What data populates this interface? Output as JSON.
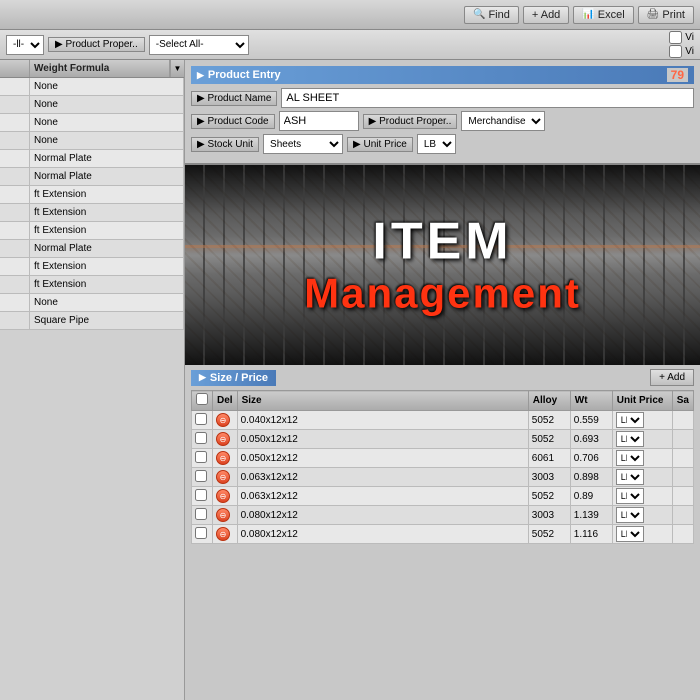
{
  "toolbar": {
    "find_label": "Find",
    "add_label": "+ Add",
    "excel_label": "Excel",
    "print_label": "Print"
  },
  "filter": {
    "all_label": "-ll-",
    "product_proper_label": "▶ Product Proper..",
    "select_all_label": "-Select All-",
    "checkbox1": "Vi",
    "checkbox2": "Vi"
  },
  "left_panel": {
    "col1_header": "",
    "col2_header": "Weight Formula",
    "rows": [
      {
        "col1": "",
        "col2": "None"
      },
      {
        "col1": "",
        "col2": "None"
      },
      {
        "col1": "",
        "col2": "None"
      },
      {
        "col1": "",
        "col2": "None"
      },
      {
        "col1": "",
        "col2": "Normal Plate"
      },
      {
        "col1": "",
        "col2": "Normal Plate"
      },
      {
        "col1": "",
        "col2": "ft Extension"
      },
      {
        "col1": "",
        "col2": "ft Extension"
      },
      {
        "col1": "",
        "col2": "ft Extension"
      },
      {
        "col1": "",
        "col2": "Normal Plate"
      },
      {
        "col1": "",
        "col2": "ft Extension"
      },
      {
        "col1": "",
        "col2": "ft Extension"
      },
      {
        "col1": "",
        "col2": "None"
      },
      {
        "col1": "",
        "col2": "Square Pipe"
      }
    ]
  },
  "product_entry": {
    "section_title": "Product Entry",
    "section_id": "79",
    "product_name_label": "▶ Product Name",
    "product_name_value": "AL SHEET",
    "product_code_label": "▶ Product Code",
    "product_code_value": "ASH",
    "product_proper_label": "▶ Product Proper..",
    "product_proper_value": "Merchandise",
    "stock_unit_label": "▶ Stock Unit",
    "stock_unit_value": "Sheets",
    "unit_price_label": "▶ Unit Price",
    "unit_price_value": "LB"
  },
  "overlay": {
    "item_text": "ITEM",
    "management_text": "Management"
  },
  "size_price": {
    "section_title": "Size / Price",
    "add_label": "+ Add",
    "columns": [
      "",
      "Del",
      "Size",
      "Alloy",
      "Wt",
      "Unit Price",
      "Sa"
    ],
    "rows": [
      {
        "check": false,
        "del": true,
        "size": "0.040x12x12",
        "alloy": "5052",
        "wt": "0.559",
        "unit_price": "LB",
        "sa": ""
      },
      {
        "check": false,
        "del": true,
        "size": "0.050x12x12",
        "alloy": "5052",
        "wt": "0.693",
        "unit_price": "LB",
        "sa": ""
      },
      {
        "check": false,
        "del": true,
        "size": "0.050x12x12",
        "alloy": "6061",
        "wt": "0.706",
        "unit_price": "LB",
        "sa": ""
      },
      {
        "check": false,
        "del": true,
        "size": "0.063x12x12",
        "alloy": "3003",
        "wt": "0.898",
        "unit_price": "LB",
        "sa": ""
      },
      {
        "check": false,
        "del": true,
        "size": "0.063x12x12",
        "alloy": "5052",
        "wt": "0.89",
        "unit_price": "LB",
        "sa": ""
      },
      {
        "check": false,
        "del": true,
        "size": "0.080x12x12",
        "alloy": "3003",
        "wt": "1.139",
        "unit_price": "LB",
        "sa": ""
      },
      {
        "check": false,
        "del": true,
        "size": "0.080x12x12",
        "alloy": "5052",
        "wt": "1.116",
        "unit_price": "LB",
        "sa": ""
      }
    ]
  }
}
